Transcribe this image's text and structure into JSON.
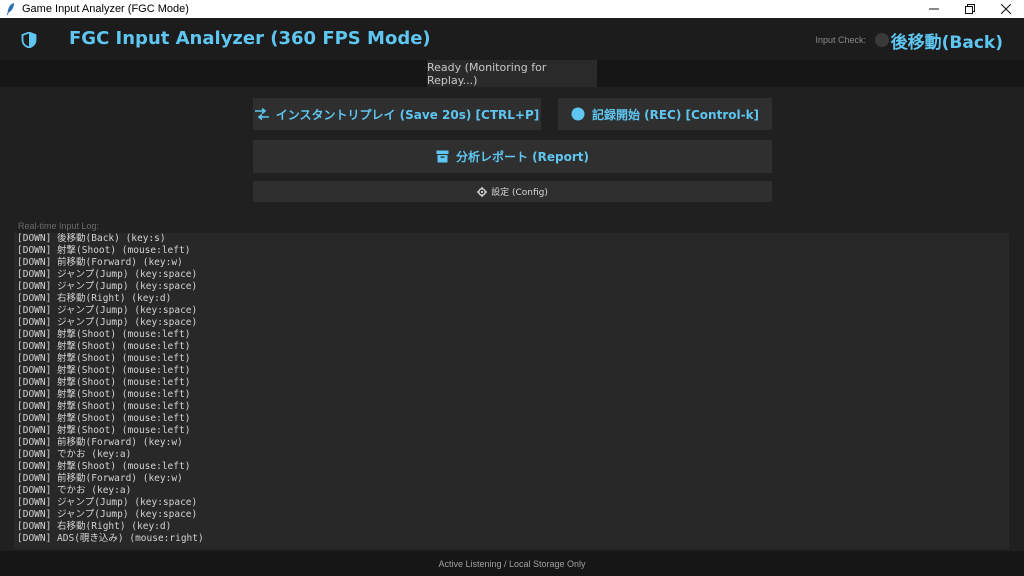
{
  "window": {
    "title": "Game Input Analyzer (FGC Mode)"
  },
  "header": {
    "title": "FGC Input Analyzer (360 FPS Mode)",
    "input_check_label": "Input Check:",
    "input_key": "後移動(Back)"
  },
  "status": "Ready (Monitoring for Replay...)",
  "buttons": {
    "replay": "インスタントリプレイ (Save 20s) [CTRL+P]",
    "rec": "記録開始 (REC) [Control-k]",
    "report": "分析レポート (Report)",
    "config": "設定 (Config)"
  },
  "log": {
    "label": "Real-time Input Log:",
    "lines": [
      "[DOWN] 後移動(Back) (key:s)",
      "[DOWN] 射撃(Shoot) (mouse:left)",
      "[DOWN] 前移動(Forward) (key:w)",
      "[DOWN] ジャンプ(Jump) (key:space)",
      "[DOWN] ジャンプ(Jump) (key:space)",
      "[DOWN] 右移動(Right) (key:d)",
      "[DOWN] ジャンプ(Jump) (key:space)",
      "[DOWN] ジャンプ(Jump) (key:space)",
      "[DOWN] 射撃(Shoot) (mouse:left)",
      "[DOWN] 射撃(Shoot) (mouse:left)",
      "[DOWN] 射撃(Shoot) (mouse:left)",
      "[DOWN] 射撃(Shoot) (mouse:left)",
      "[DOWN] 射撃(Shoot) (mouse:left)",
      "[DOWN] 射撃(Shoot) (mouse:left)",
      "[DOWN] 射撃(Shoot) (mouse:left)",
      "[DOWN] 射撃(Shoot) (mouse:left)",
      "[DOWN] 射撃(Shoot) (mouse:left)",
      "[DOWN] 前移動(Forward) (key:w)",
      "[DOWN] でかお (key:a)",
      "[DOWN] 射撃(Shoot) (mouse:left)",
      "[DOWN] 前移動(Forward) (key:w)",
      "[DOWN] でかお (key:a)",
      "[DOWN] ジャンプ(Jump) (key:space)",
      "[DOWN] ジャンプ(Jump) (key:space)",
      "[DOWN] 右移動(Right) (key:d)",
      "[DOWN] ADS(覗き込み) (mouse:right)"
    ]
  },
  "footer": "Active Listening / Local Storage Only",
  "colors": {
    "accent": "#5ec6f0",
    "background": "#202020",
    "button": "#2f2f2f"
  },
  "icons": {
    "app": "feather-icon",
    "shield": "shield-icon",
    "replay": "transfer-icon",
    "rec": "record-dot-icon",
    "report": "archive-box-icon",
    "config": "gear-icon"
  }
}
